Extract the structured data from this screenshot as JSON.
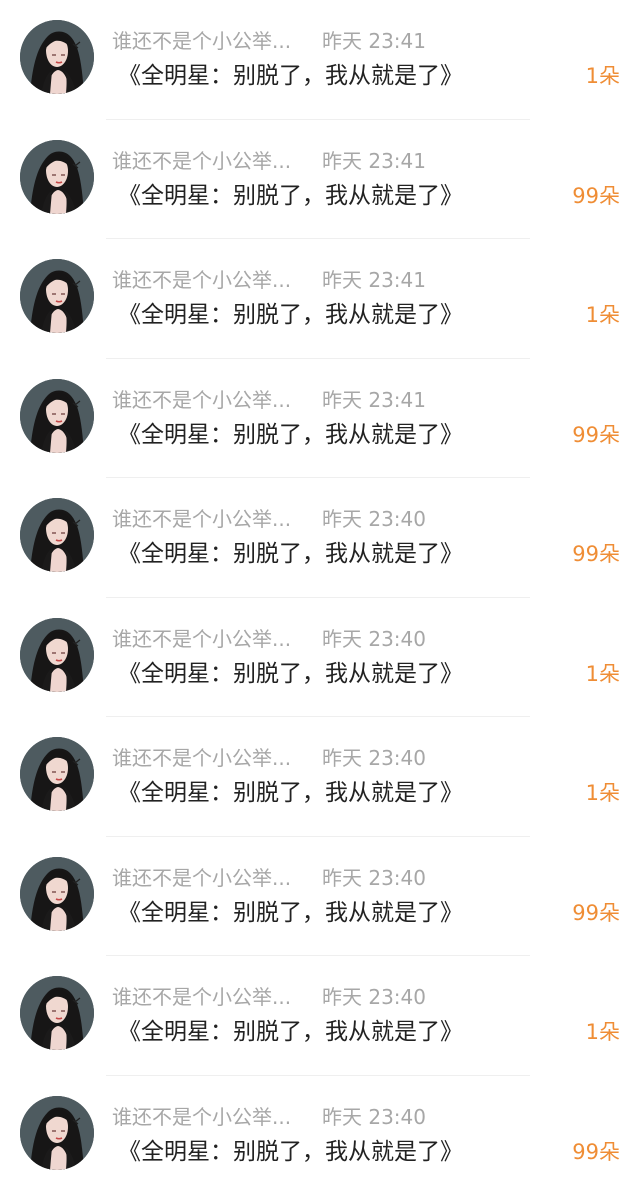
{
  "accent_color": "#ef8d35",
  "rows": [
    {
      "name": "谁还不是个小公举...",
      "time": "昨天 23:41",
      "message": "《全明星：别脱了，我从就是了》",
      "gift": "1朵"
    },
    {
      "name": "谁还不是个小公举...",
      "time": "昨天 23:41",
      "message": "《全明星：别脱了，我从就是了》",
      "gift": "99朵"
    },
    {
      "name": "谁还不是个小公举...",
      "time": "昨天 23:41",
      "message": "《全明星：别脱了，我从就是了》",
      "gift": "1朵"
    },
    {
      "name": "谁还不是个小公举...",
      "time": "昨天 23:41",
      "message": "《全明星：别脱了，我从就是了》",
      "gift": "99朵"
    },
    {
      "name": "谁还不是个小公举...",
      "time": "昨天 23:40",
      "message": "《全明星：别脱了，我从就是了》",
      "gift": "99朵"
    },
    {
      "name": "谁还不是个小公举...",
      "time": "昨天 23:40",
      "message": "《全明星：别脱了，我从就是了》",
      "gift": "1朵"
    },
    {
      "name": "谁还不是个小公举...",
      "time": "昨天 23:40",
      "message": "《全明星：别脱了，我从就是了》",
      "gift": "1朵"
    },
    {
      "name": "谁还不是个小公举...",
      "time": "昨天 23:40",
      "message": "《全明星：别脱了，我从就是了》",
      "gift": "99朵"
    },
    {
      "name": "谁还不是个小公举...",
      "time": "昨天 23:40",
      "message": "《全明星：别脱了，我从就是了》",
      "gift": "1朵"
    },
    {
      "name": "谁还不是个小公举...",
      "time": "昨天 23:40",
      "message": "《全明星：别脱了，我从就是了》",
      "gift": "99朵"
    }
  ]
}
